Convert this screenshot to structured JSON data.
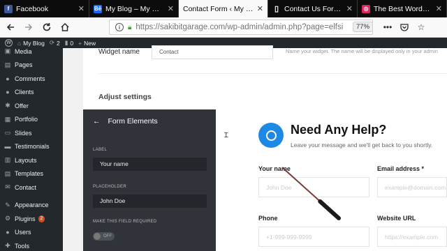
{
  "tabs": [
    {
      "title": "Facebook",
      "icon": "facebook-icon",
      "icon_glyph": "f",
      "icon_color": "#3b5998",
      "active": false
    },
    {
      "title": "My Blog – My WordPress…",
      "icon": "behance-icon",
      "icon_glyph": "Bē",
      "icon_color": "#1769ff",
      "active": false
    },
    {
      "title": "Contact Form ‹ My Blog — …",
      "icon": "",
      "icon_glyph": "",
      "icon_color": "",
      "active": true
    },
    {
      "title": "Contact Us Form - We…",
      "icon": "document-icon",
      "icon_glyph": "▯",
      "icon_color": "#ffffff",
      "active": false
    },
    {
      "title": "The Best WordPress C…",
      "icon": "elfsight-icon",
      "icon_glyph": "◎",
      "icon_color": "#e0245e",
      "active": false
    }
  ],
  "nav": {
    "url": "https://sakibitgarage.com/wp-admin/admin.php?page=elfsi",
    "zoom": "77%"
  },
  "adminbar": {
    "site": "My Blog",
    "updates": "2",
    "comments": "0",
    "new": "New"
  },
  "sidebar": {
    "items": [
      {
        "label": "Media",
        "icon": "media-icon",
        "glyph": "▣"
      },
      {
        "label": "Pages",
        "icon": "pages-icon",
        "glyph": "▤"
      },
      {
        "label": "Comments",
        "icon": "comments-icon",
        "glyph": "●"
      },
      {
        "label": "Clients",
        "icon": "clients-icon",
        "glyph": "●"
      },
      {
        "label": "Offer",
        "icon": "offer-icon",
        "glyph": "✱"
      },
      {
        "label": "Portfolio",
        "icon": "portfolio-icon",
        "glyph": "▦"
      },
      {
        "label": "Slides",
        "icon": "slides-icon",
        "glyph": "▭"
      },
      {
        "label": "Testimonials",
        "icon": "testimonials-icon",
        "glyph": "▬"
      },
      {
        "label": "Layouts",
        "icon": "layouts-icon",
        "glyph": "▥"
      },
      {
        "label": "Templates",
        "icon": "templates-icon",
        "glyph": "▤"
      },
      {
        "label": "Contact",
        "icon": "contact-icon",
        "glyph": "✉"
      },
      {
        "label": "Appearance",
        "icon": "appearance-icon",
        "glyph": "✎"
      },
      {
        "label": "Plugins",
        "icon": "plugins-icon",
        "glyph": "⚙",
        "badge": "2"
      },
      {
        "label": "Users",
        "icon": "users-icon",
        "glyph": "●"
      },
      {
        "label": "Tools",
        "icon": "tools-icon",
        "glyph": "✚"
      }
    ]
  },
  "widget": {
    "name_label": "Widget name",
    "name_value": "Contact",
    "help": "Name your widget. The name will be displayed only in your admin",
    "adjust": "Adjust settings"
  },
  "editor": {
    "title": "Form Elements",
    "label_caption": "LABEL",
    "label_value": "Your name",
    "placeholder_caption": "PLACEHOLDER",
    "placeholder_value": "John Doe",
    "required_caption": "MAKE THIS FIELD REQUIRED",
    "toggle_state": "OFF"
  },
  "preview": {
    "title": "Need Any Help?",
    "subtitle": "Leave your message and we'll get back to you shortly.",
    "fields": [
      {
        "label": "Your name",
        "placeholder": "John Doe"
      },
      {
        "label": "Email address *",
        "placeholder": "example@domain.com"
      },
      {
        "label": "Phone",
        "placeholder": "+1-999-999-9999"
      },
      {
        "label": "Website URL",
        "placeholder": "https://example.com"
      }
    ]
  }
}
